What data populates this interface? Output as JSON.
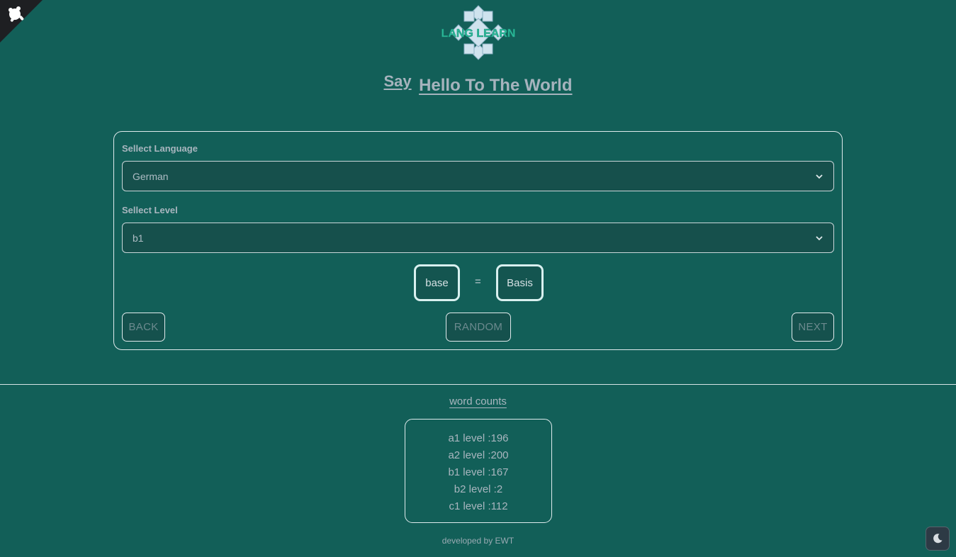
{
  "header": {
    "logo_text": "LANG LEARN",
    "say_label": "Say",
    "headline": "Hello To The World"
  },
  "form": {
    "language_label": "Sellect Language",
    "language_value": "German",
    "level_label": "Sellect Level",
    "level_value": "b1"
  },
  "card_word": {
    "source": "base",
    "separator": "=",
    "translation": "Basis"
  },
  "nav_buttons": {
    "back": "BACK",
    "random": "RANDOM",
    "next": "NEXT"
  },
  "word_counts": {
    "title": "word counts",
    "lines": [
      "a1 level :196",
      "a2 level :200",
      "b1 level :167",
      "b2 level :2",
      "c1 level :112"
    ]
  },
  "footer": {
    "text": "developed by EWT"
  },
  "icons": {
    "corner": "github-corner-icon",
    "theme": "moon-icon",
    "select_arrow": "chevron-down-icon"
  },
  "colors": {
    "background": "#125f58",
    "accent": "#2bb99a",
    "logo_fill": "#cfe3ee"
  }
}
